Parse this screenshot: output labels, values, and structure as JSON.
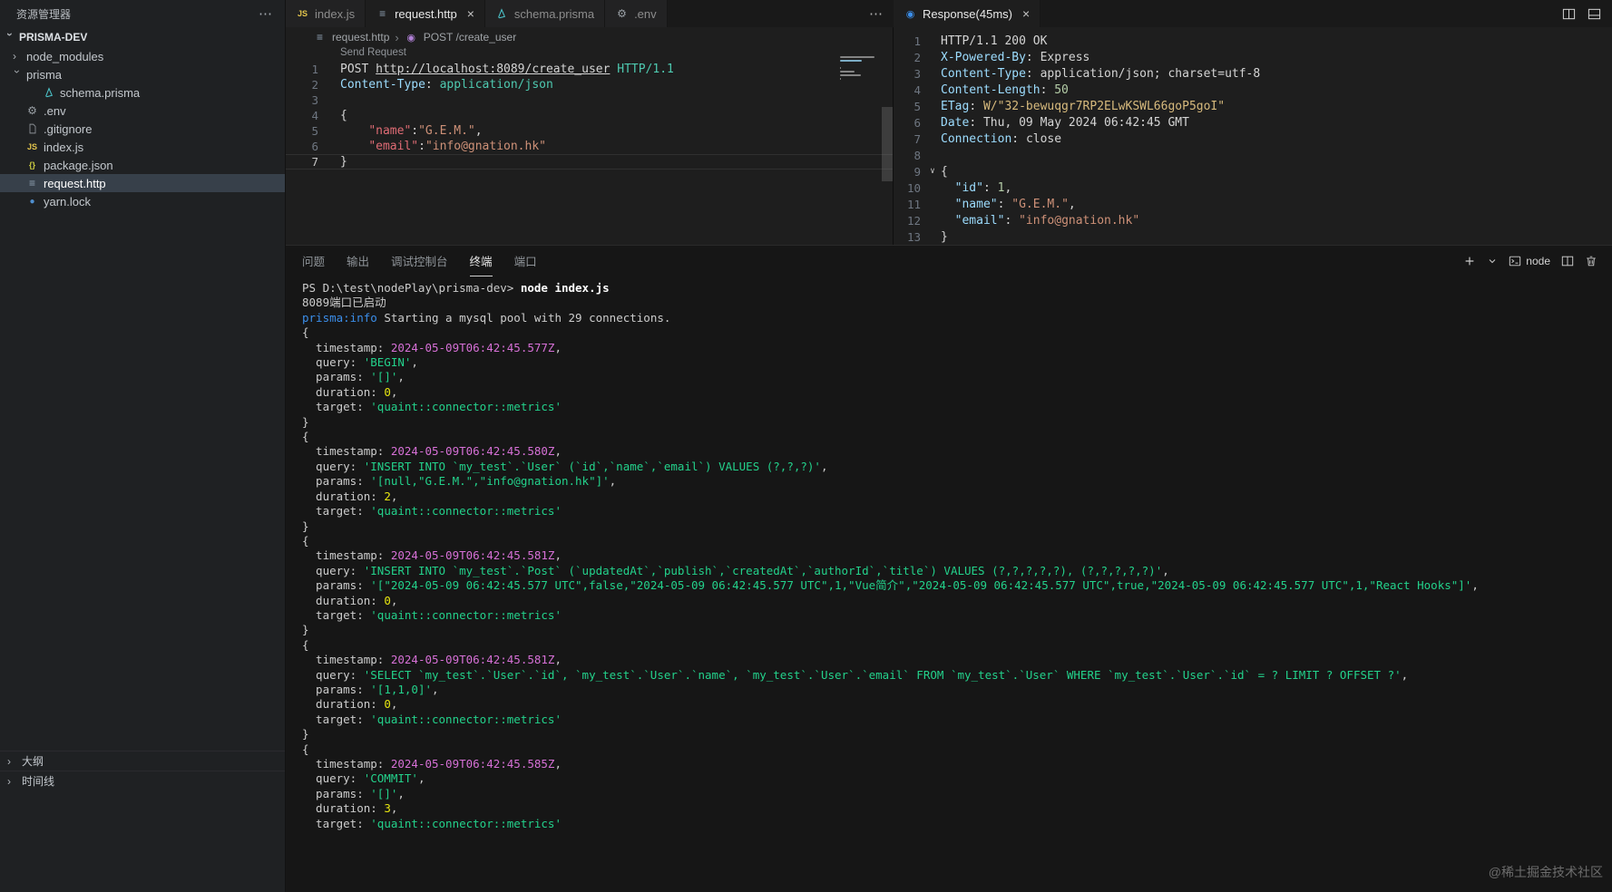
{
  "colors": {
    "accent": "#3b8eea",
    "selection_bg": "#37404a",
    "terminal_green": "#23d18b",
    "terminal_magenta": "#d670d6"
  },
  "sidebar": {
    "header": "资源管理器",
    "more": "⋯",
    "items": [
      {
        "label": "PRISMA-DEV",
        "type": "root",
        "chevron": "down"
      },
      {
        "label": "node_modules",
        "type": "folder",
        "chevron": "right",
        "depth": 0
      },
      {
        "label": "prisma",
        "type": "folder",
        "chevron": "down",
        "depth": 0
      },
      {
        "label": "schema.prisma",
        "icon": "prisma",
        "depth": 1
      },
      {
        "label": ".env",
        "icon": "gear",
        "depth": 0
      },
      {
        "label": ".gitignore",
        "icon": "file",
        "depth": 0
      },
      {
        "label": "index.js",
        "icon": "js",
        "depth": 0
      },
      {
        "label": "package.json",
        "icon": "braces",
        "depth": 0
      },
      {
        "label": "request.http",
        "icon": "http",
        "depth": 0,
        "selected": true
      },
      {
        "label": "yarn.lock",
        "icon": "yarn",
        "depth": 0
      }
    ],
    "sections": [
      {
        "label": "大纲",
        "name": "outline"
      },
      {
        "label": "时间线",
        "name": "timeline"
      }
    ]
  },
  "tabs": {
    "left": [
      {
        "label": "index.js",
        "icon": "js",
        "active": false,
        "close": false
      },
      {
        "label": "request.http",
        "icon": "http",
        "active": true,
        "close": true
      },
      {
        "label": "schema.prisma",
        "icon": "prisma",
        "active": false,
        "close": false
      },
      {
        "label": ".env",
        "icon": "gear",
        "active": false,
        "close": false
      }
    ],
    "left_more": "⋯",
    "right": [
      {
        "label": "Response(45ms)",
        "icon": "resp",
        "active": true,
        "close": true
      }
    ]
  },
  "breadcrumb": {
    "file": "request.http",
    "separator": "›",
    "route": "POST /create_user"
  },
  "editor": {
    "codelens": "Send Request",
    "current_line": 7,
    "lines": [
      [
        {
          "t": "POST ",
          "c": "ep"
        },
        {
          "t": "http://localhost:8089/create_user",
          "c": "eurl"
        },
        {
          "t": " HTTP/1.1",
          "c": "ever"
        }
      ],
      [
        {
          "t": "Content-Type",
          "c": "ehk"
        },
        {
          "t": ": ",
          "c": "ep"
        },
        {
          "t": "application/json",
          "c": "ehv"
        }
      ],
      [],
      [
        {
          "t": "{",
          "c": "ep"
        }
      ],
      [
        {
          "t": "    ",
          "c": "ep"
        },
        {
          "t": "\"name\"",
          "c": "ek"
        },
        {
          "t": ":",
          "c": "ep"
        },
        {
          "t": "\"G.E.M.\"",
          "c": "es"
        },
        {
          "t": ",",
          "c": "ep"
        }
      ],
      [
        {
          "t": "    ",
          "c": "ep"
        },
        {
          "t": "\"email\"",
          "c": "ek"
        },
        {
          "t": ":",
          "c": "ep"
        },
        {
          "t": "\"info@gnation.hk\"",
          "c": "es"
        }
      ],
      [
        {
          "t": "}",
          "c": "ep"
        }
      ]
    ]
  },
  "response": {
    "fold_line": 9,
    "lines": [
      [
        {
          "t": "HTTP/1.1 200 OK",
          "c": "ep"
        }
      ],
      [
        {
          "t": "X-Powered-By",
          "c": "rhk"
        },
        {
          "t": ": ",
          "c": "ep"
        },
        {
          "t": "Express",
          "c": "ep"
        }
      ],
      [
        {
          "t": "Content-Type",
          "c": "rhk"
        },
        {
          "t": ": ",
          "c": "ep"
        },
        {
          "t": "application/json; charset=utf-8",
          "c": "ep"
        }
      ],
      [
        {
          "t": "Content-Length",
          "c": "rhk"
        },
        {
          "t": ": ",
          "c": "ep"
        },
        {
          "t": "50",
          "c": "rnum"
        }
      ],
      [
        {
          "t": "ETag",
          "c": "rhk"
        },
        {
          "t": ": ",
          "c": "ep"
        },
        {
          "t": "W/\"32-bewuqgr7RP2ELwKSWL66goP5goI\"",
          "c": "retag"
        }
      ],
      [
        {
          "t": "Date",
          "c": "rhk"
        },
        {
          "t": ": ",
          "c": "ep"
        },
        {
          "t": "Thu, 09 May 2024 06:42:45 GMT",
          "c": "ep"
        }
      ],
      [
        {
          "t": "Connection",
          "c": "rhk"
        },
        {
          "t": ": ",
          "c": "ep"
        },
        {
          "t": "close",
          "c": "ep"
        }
      ],
      [],
      [
        {
          "t": "{",
          "c": "ep"
        }
      ],
      [
        {
          "t": "  ",
          "c": "ep"
        },
        {
          "t": "\"id\"",
          "c": "rk"
        },
        {
          "t": ": ",
          "c": "ep"
        },
        {
          "t": "1",
          "c": "rnum"
        },
        {
          "t": ",",
          "c": "ep"
        }
      ],
      [
        {
          "t": "  ",
          "c": "ep"
        },
        {
          "t": "\"name\"",
          "c": "rk"
        },
        {
          "t": ": ",
          "c": "ep"
        },
        {
          "t": "\"G.E.M.\"",
          "c": "rs"
        },
        {
          "t": ",",
          "c": "ep"
        }
      ],
      [
        {
          "t": "  ",
          "c": "ep"
        },
        {
          "t": "\"email\"",
          "c": "rk"
        },
        {
          "t": ": ",
          "c": "ep"
        },
        {
          "t": "\"info@gnation.hk\"",
          "c": "rs"
        }
      ],
      [
        {
          "t": "}",
          "c": "ep"
        }
      ]
    ]
  },
  "panel": {
    "tabs": [
      {
        "label": "问题",
        "name": "problems",
        "active": false
      },
      {
        "label": "输出",
        "name": "output",
        "active": false
      },
      {
        "label": "调试控制台",
        "name": "debug-console",
        "active": false
      },
      {
        "label": "终端",
        "name": "terminal",
        "active": true
      },
      {
        "label": "端口",
        "name": "ports",
        "active": false
      }
    ],
    "terminal_process": "node",
    "lines": [
      [
        {
          "t": "PS D:\\test\\nodePlay\\prisma-dev> ",
          "c": "tp"
        },
        {
          "t": "node index.js",
          "c": "tb"
        }
      ],
      [
        {
          "t": "8089端口已启动",
          "c": "tp"
        }
      ],
      [
        {
          "t": "prisma:info",
          "c": "tblue"
        },
        {
          "t": " Starting a mysql pool with 29 connections.",
          "c": "tp"
        }
      ],
      [
        {
          "t": "{",
          "c": "tp"
        }
      ],
      [
        {
          "t": "  timestamp: ",
          "c": "tp"
        },
        {
          "t": "2024-05-09T06:42:45.577Z",
          "c": "tm"
        },
        {
          "t": ",",
          "c": "tp"
        }
      ],
      [
        {
          "t": "  query: ",
          "c": "tp"
        },
        {
          "t": "'BEGIN'",
          "c": "tg"
        },
        {
          "t": ",",
          "c": "tp"
        }
      ],
      [
        {
          "t": "  params: ",
          "c": "tp"
        },
        {
          "t": "'[]'",
          "c": "tg"
        },
        {
          "t": ",",
          "c": "tp"
        }
      ],
      [
        {
          "t": "  duration: ",
          "c": "tp"
        },
        {
          "t": "0",
          "c": "ty"
        },
        {
          "t": ",",
          "c": "tp"
        }
      ],
      [
        {
          "t": "  target: ",
          "c": "tp"
        },
        {
          "t": "'quaint::connector::metrics'",
          "c": "tg"
        }
      ],
      [
        {
          "t": "}",
          "c": "tp"
        }
      ],
      [
        {
          "t": "{",
          "c": "tp"
        }
      ],
      [
        {
          "t": "  timestamp: ",
          "c": "tp"
        },
        {
          "t": "2024-05-09T06:42:45.580Z",
          "c": "tm"
        },
        {
          "t": ",",
          "c": "tp"
        }
      ],
      [
        {
          "t": "  query: ",
          "c": "tp"
        },
        {
          "t": "'INSERT INTO `my_test`.`User` (`id`,`name`,`email`) VALUES (?,?,?)'",
          "c": "tg"
        },
        {
          "t": ",",
          "c": "tp"
        }
      ],
      [
        {
          "t": "  params: ",
          "c": "tp"
        },
        {
          "t": "'[null,\"G.E.M.\",\"info@gnation.hk\"]'",
          "c": "tg"
        },
        {
          "t": ",",
          "c": "tp"
        }
      ],
      [
        {
          "t": "  duration: ",
          "c": "tp"
        },
        {
          "t": "2",
          "c": "ty"
        },
        {
          "t": ",",
          "c": "tp"
        }
      ],
      [
        {
          "t": "  target: ",
          "c": "tp"
        },
        {
          "t": "'quaint::connector::metrics'",
          "c": "tg"
        }
      ],
      [
        {
          "t": "}",
          "c": "tp"
        }
      ],
      [
        {
          "t": "{",
          "c": "tp"
        }
      ],
      [
        {
          "t": "  timestamp: ",
          "c": "tp"
        },
        {
          "t": "2024-05-09T06:42:45.581Z",
          "c": "tm"
        },
        {
          "t": ",",
          "c": "tp"
        }
      ],
      [
        {
          "t": "  query: ",
          "c": "tp"
        },
        {
          "t": "'INSERT INTO `my_test`.`Post` (`updatedAt`,`publish`,`createdAt`,`authorId`,`title`) VALUES (?,?,?,?,?), (?,?,?,?,?)'",
          "c": "tg"
        },
        {
          "t": ",",
          "c": "tp"
        }
      ],
      [
        {
          "t": "  params: ",
          "c": "tp"
        },
        {
          "t": "'[\"2024-05-09 06:42:45.577 UTC\",false,\"2024-05-09 06:42:45.577 UTC\",1,\"Vue简介\",\"2024-05-09 06:42:45.577 UTC\",true,\"2024-05-09 06:42:45.577 UTC\",1,\"React Hooks\"]'",
          "c": "tg"
        },
        {
          "t": ",",
          "c": "tp"
        }
      ],
      [
        {
          "t": "  duration: ",
          "c": "tp"
        },
        {
          "t": "0",
          "c": "ty"
        },
        {
          "t": ",",
          "c": "tp"
        }
      ],
      [
        {
          "t": "  target: ",
          "c": "tp"
        },
        {
          "t": "'quaint::connector::metrics'",
          "c": "tg"
        }
      ],
      [
        {
          "t": "}",
          "c": "tp"
        }
      ],
      [
        {
          "t": "{",
          "c": "tp"
        }
      ],
      [
        {
          "t": "  timestamp: ",
          "c": "tp"
        },
        {
          "t": "2024-05-09T06:42:45.581Z",
          "c": "tm"
        },
        {
          "t": ",",
          "c": "tp"
        }
      ],
      [
        {
          "t": "  query: ",
          "c": "tp"
        },
        {
          "t": "'SELECT `my_test`.`User`.`id`, `my_test`.`User`.`name`, `my_test`.`User`.`email` FROM `my_test`.`User` WHERE `my_test`.`User`.`id` = ? LIMIT ? OFFSET ?'",
          "c": "tg"
        },
        {
          "t": ",",
          "c": "tp"
        }
      ],
      [
        {
          "t": "  params: ",
          "c": "tp"
        },
        {
          "t": "'[1,1,0]'",
          "c": "tg"
        },
        {
          "t": ",",
          "c": "tp"
        }
      ],
      [
        {
          "t": "  duration: ",
          "c": "tp"
        },
        {
          "t": "0",
          "c": "ty"
        },
        {
          "t": ",",
          "c": "tp"
        }
      ],
      [
        {
          "t": "  target: ",
          "c": "tp"
        },
        {
          "t": "'quaint::connector::metrics'",
          "c": "tg"
        }
      ],
      [
        {
          "t": "}",
          "c": "tp"
        }
      ],
      [
        {
          "t": "{",
          "c": "tp"
        }
      ],
      [
        {
          "t": "  timestamp: ",
          "c": "tp"
        },
        {
          "t": "2024-05-09T06:42:45.585Z",
          "c": "tm"
        },
        {
          "t": ",",
          "c": "tp"
        }
      ],
      [
        {
          "t": "  query: ",
          "c": "tp"
        },
        {
          "t": "'COMMIT'",
          "c": "tg"
        },
        {
          "t": ",",
          "c": "tp"
        }
      ],
      [
        {
          "t": "  params: ",
          "c": "tp"
        },
        {
          "t": "'[]'",
          "c": "tg"
        },
        {
          "t": ",",
          "c": "tp"
        }
      ],
      [
        {
          "t": "  duration: ",
          "c": "tp"
        },
        {
          "t": "3",
          "c": "ty"
        },
        {
          "t": ",",
          "c": "tp"
        }
      ],
      [
        {
          "t": "  target: ",
          "c": "tp"
        },
        {
          "t": "'quaint::connector::metrics'",
          "c": "tg"
        }
      ]
    ]
  },
  "watermark": "@稀土掘金技术社区"
}
